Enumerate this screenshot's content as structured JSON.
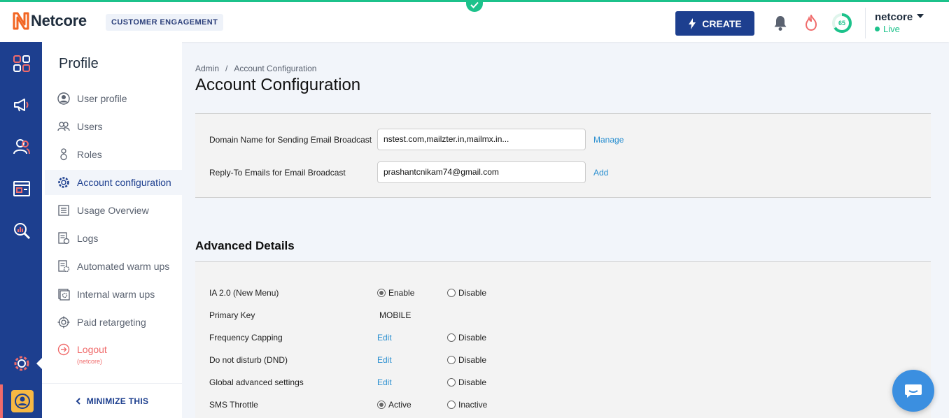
{
  "header": {
    "brand": "Netcore",
    "product_badge": "CUSTOMER ENGAGEMENT",
    "create_label": "CREATE",
    "score": "65",
    "account_name": "netcore",
    "account_status": "Live",
    "colors": {
      "accent": "#1cc28b",
      "primary": "#1d3f8f",
      "logo": "#f26522",
      "alert": "#f06b6b"
    }
  },
  "rail": {
    "icons": [
      "dashboard-icon",
      "megaphone-icon",
      "users-icon",
      "browser-window-icon",
      "analytics-search-icon",
      "settings-icon",
      "profile-icon"
    ]
  },
  "menu": {
    "title": "Profile",
    "items": [
      {
        "label": "User profile",
        "icon": "user-circle-icon"
      },
      {
        "label": "Users",
        "icon": "users-icon"
      },
      {
        "label": "Roles",
        "icon": "roles-icon"
      },
      {
        "label": "Account configuration",
        "icon": "gear-icon",
        "active": true
      },
      {
        "label": "Usage Overview",
        "icon": "list-icon"
      },
      {
        "label": "Logs",
        "icon": "log-icon"
      },
      {
        "label": "Automated warm ups",
        "icon": "automated-icon"
      },
      {
        "label": "Internal warm ups",
        "icon": "internal-icon"
      },
      {
        "label": "Paid retargeting",
        "icon": "target-icon"
      },
      {
        "label": "Logout",
        "icon": "logout-icon"
      }
    ],
    "logout_sub": "(netcore)",
    "minimize_label": "MINIMIZE THIS"
  },
  "main": {
    "breadcrumb": {
      "root": "Admin",
      "sep": "/",
      "current": "Account Configuration"
    },
    "title": "Account Configuration",
    "email": {
      "domain_label": "Domain Name for Sending Email Broadcast",
      "domain_value": "nstest.com,mailzter.in,mailmx.in...",
      "domain_link": "Manage",
      "reply_label": "Reply-To Emails for Email Broadcast",
      "reply_value": "prashantcnikam74@gmail.com",
      "reply_link": "Add"
    },
    "advanced": {
      "title": "Advanced Details",
      "rows": [
        {
          "label": "IA 2.0 (New Menu)",
          "opt1": "Enable",
          "opt1_checked": true,
          "opt2": "Disable",
          "opt2_checked": false
        },
        {
          "label": "Primary Key",
          "value": "MOBILE"
        },
        {
          "label": "Frequency Capping",
          "link": "Edit",
          "opt2": "Disable",
          "opt2_checked": false
        },
        {
          "label": "Do not disturb (DND)",
          "link": "Edit",
          "opt2": "Disable",
          "opt2_checked": false
        },
        {
          "label": "Global advanced settings",
          "link": "Edit",
          "opt2": "Disable",
          "opt2_checked": false
        },
        {
          "label": "SMS Throttle",
          "opt1": "Active",
          "opt1_checked": true,
          "opt2": "Inactive",
          "opt2_checked": false
        }
      ]
    }
  }
}
